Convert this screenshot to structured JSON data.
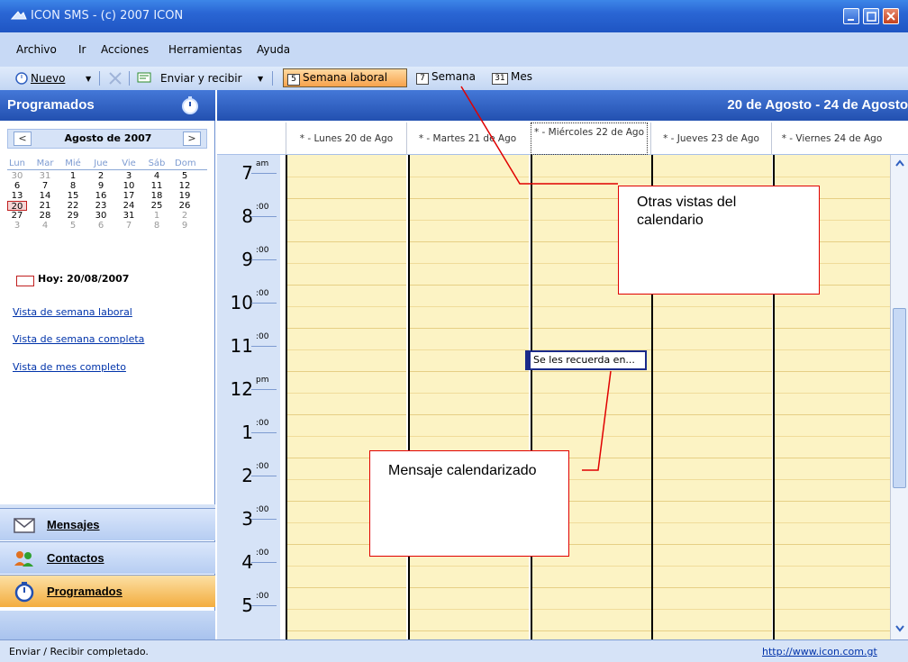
{
  "window": {
    "title": "ICON SMS - (c) 2007 ICON"
  },
  "menu": {
    "items": [
      "Archivo",
      "Ir",
      "Acciones",
      "Herramientas",
      "Ayuda"
    ]
  },
  "toolbar": {
    "new_label": "Nuevo",
    "send_receive_label": "Enviar y recibir",
    "views": [
      {
        "num": "5",
        "label": "Semana laboral",
        "active": true
      },
      {
        "num": "7",
        "label": "Semana",
        "active": false
      },
      {
        "num": "31",
        "label": "Mes",
        "active": false
      }
    ]
  },
  "left_pane": {
    "title": "Programados",
    "calendar": {
      "month_label": "Agosto de 2007",
      "prev": "<",
      "next": ">",
      "days_of_week": [
        "Lun",
        "Mar",
        "Mié",
        "Jue",
        "Vie",
        "Sáb",
        "Dom"
      ],
      "weeks": [
        [
          "30",
          "31",
          "1",
          "2",
          "3",
          "4",
          "5"
        ],
        [
          "6",
          "7",
          "8",
          "9",
          "10",
          "11",
          "12"
        ],
        [
          "13",
          "14",
          "15",
          "16",
          "17",
          "18",
          "19"
        ],
        [
          "20",
          "21",
          "22",
          "23",
          "24",
          "25",
          "26"
        ],
        [
          "27",
          "28",
          "29",
          "30",
          "31",
          "1",
          "2"
        ],
        [
          "3",
          "4",
          "5",
          "6",
          "7",
          "8",
          "9"
        ]
      ],
      "selected_day": "20",
      "today_label": "Hoy: 20/08/2007"
    },
    "links": [
      "Vista de semana laboral",
      "Vista de semana completa",
      "Vista de mes completo"
    ],
    "nav_buttons": [
      {
        "label": "Mensajes",
        "icon": "envelope-icon",
        "active": false
      },
      {
        "label": "Contactos",
        "icon": "contacts-icon",
        "active": false
      },
      {
        "label": "Programados",
        "icon": "stopwatch-icon",
        "active": true
      }
    ]
  },
  "main": {
    "range_title": "20 de Agosto - 24 de Agosto",
    "day_headers": [
      "* - Lunes 20 de Ago",
      "* - Martes 21 de Ago",
      "* - Miércoles 22 de Ago",
      "* - Jueves 23 de Ago",
      "* - Viernes 24 de Ago"
    ],
    "hours": [
      {
        "hour": "7",
        "suffix": "am"
      },
      {
        "hour": "8",
        "suffix": ":00"
      },
      {
        "hour": "9",
        "suffix": ":00"
      },
      {
        "hour": "10",
        "suffix": ":00"
      },
      {
        "hour": "11",
        "suffix": ":00"
      },
      {
        "hour": "12",
        "suffix": "pm"
      },
      {
        "hour": "1",
        "suffix": ":00"
      },
      {
        "hour": "2",
        "suffix": ":00"
      },
      {
        "hour": "3",
        "suffix": ":00"
      },
      {
        "hour": "4",
        "suffix": ":00"
      },
      {
        "hour": "5",
        "suffix": ":00"
      }
    ],
    "event": {
      "text": "Se les recuerda en...",
      "day": "Miércoles 22 de Ago",
      "time": "11:00"
    }
  },
  "callouts": {
    "other_views": "Otras vistas del calendario",
    "scheduled_message": "Mensaje calendarizado"
  },
  "status": {
    "text": "Enviar / Recibir completado.",
    "url": "http://www.icon.com.gt"
  },
  "colors": {
    "title_bar": "#2a66d4",
    "active_view": "#f7a24b",
    "day_column": "#fcf3c4",
    "callout_border": "#e00000"
  }
}
